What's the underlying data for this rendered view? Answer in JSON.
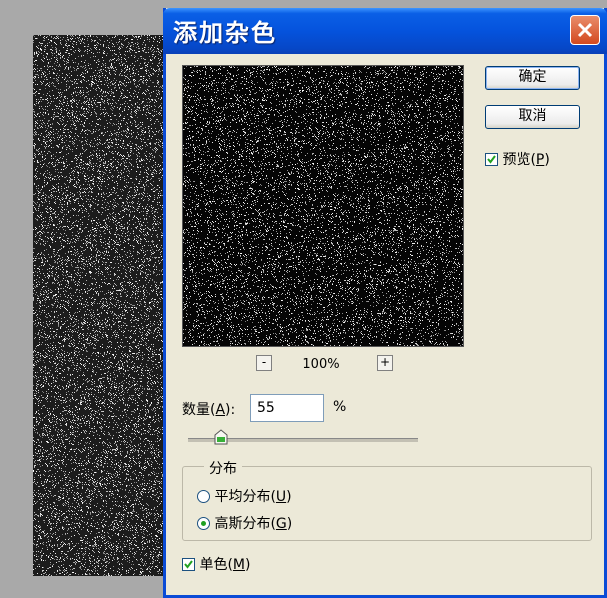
{
  "dialog": {
    "title": "添加杂色",
    "ok_label": "确定",
    "cancel_label": "取消",
    "preview_label": "预览",
    "preview_mnemonic": "P",
    "preview_checked": true
  },
  "zoom": {
    "minus": "-",
    "level": "100%",
    "plus": "+"
  },
  "amount": {
    "label": "数量",
    "mnemonic": "A",
    "value": "55",
    "unit": "%"
  },
  "distribution": {
    "label": "分布",
    "uniform_label": "平均分布",
    "uniform_mnemonic": "U",
    "gaussian_label": "高斯分布",
    "gaussian_mnemonic": "G",
    "selected": "gaussian"
  },
  "monochrome": {
    "label": "单色",
    "mnemonic": "M",
    "checked": true
  },
  "colors": {
    "title_bar": "#0553dd",
    "close_button": "#d3491f",
    "dialog_bg": "#ece9d8",
    "workspace": "#a9a9a9"
  },
  "icons": {
    "close": "close-icon",
    "check": "checkmark-icon",
    "slider": "slider-thumb-icon"
  }
}
